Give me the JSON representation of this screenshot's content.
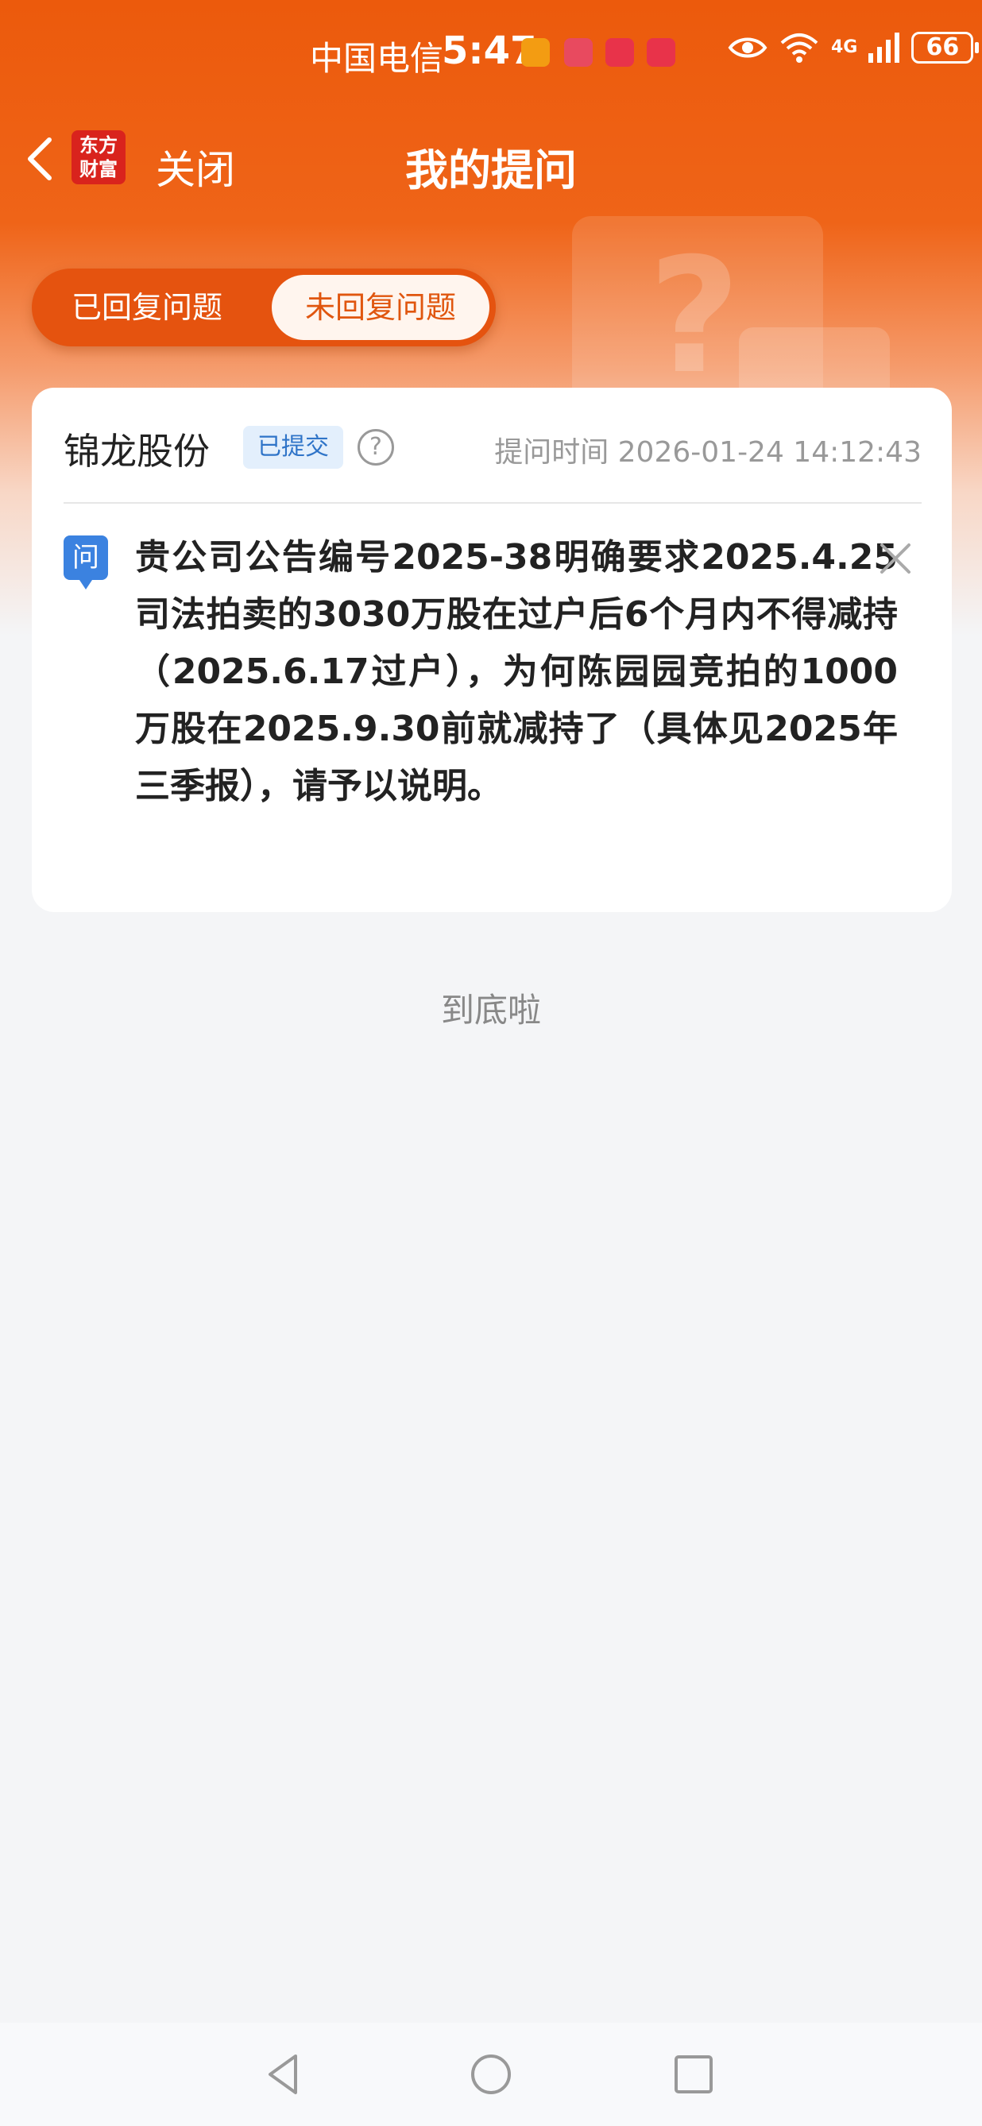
{
  "status_bar": {
    "carrier": "中国电信",
    "time": "5:47",
    "network": "4G",
    "battery": "66",
    "notification_icons": [
      "orange-app-icon",
      "red-app-icon",
      "red-app-icon",
      "red-app-icon"
    ],
    "right_icons": [
      "eye-icon",
      "wifi-icon",
      "signal-icon",
      "battery-icon"
    ]
  },
  "header": {
    "app_logo": "东方财富",
    "close_label": "关闭",
    "title": "我的提问"
  },
  "tabs": [
    {
      "label": "已回复问题",
      "active": false
    },
    {
      "label": "未回复问题",
      "active": true
    }
  ],
  "question_card": {
    "company": "锦龙股份",
    "status_badge": "已提交",
    "time_label": "提问时间 2026-01-24 14:12:43",
    "question_icon": "问",
    "question_text": "贵公司公告编号2025-38明确要求2025.4.25司法拍卖的3030万股在过户后6个月内不得减持（2025.6.17过户），为何陈园园竞拍的1000万股在2025.9.30前就减持了（具体见2025年三季报），请予以说明。"
  },
  "bottom_tip": "到底啦",
  "colors": {
    "brand_orange": "#ec5a0c",
    "badge_blue": "#2f74c8",
    "question_icon_blue": "#3b82e0"
  }
}
